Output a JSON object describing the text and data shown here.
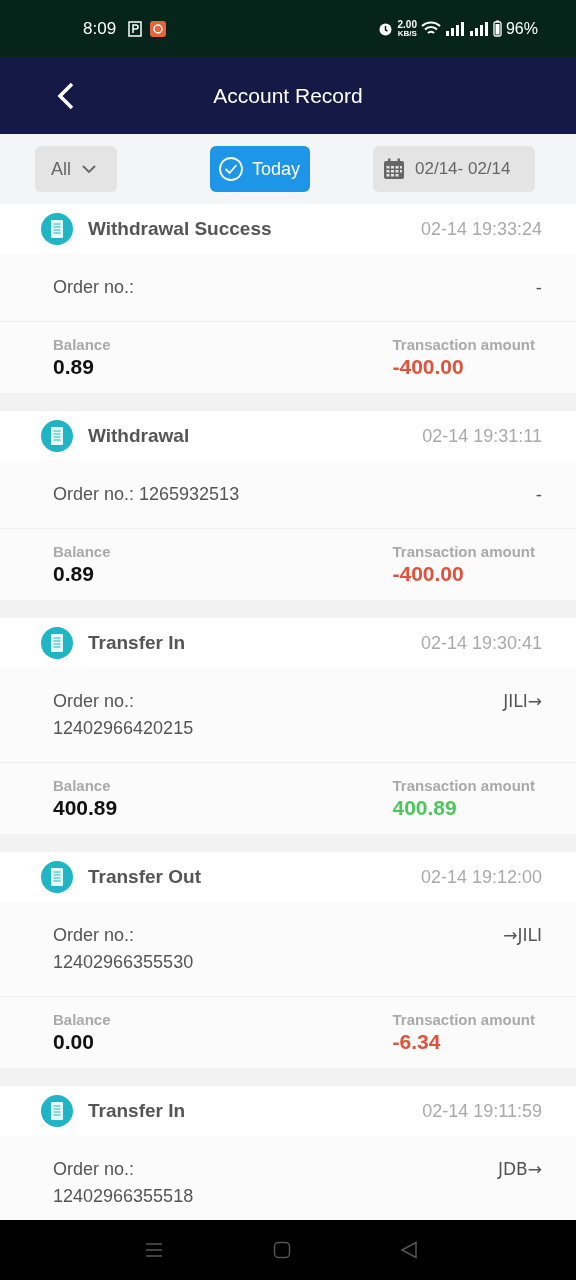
{
  "status_bar": {
    "time": "8:09",
    "speed": "2.00",
    "speed_unit": "KB/S",
    "battery": "96%"
  },
  "header": {
    "title": "Account Record"
  },
  "filters": {
    "type": {
      "label": "All"
    },
    "today": {
      "label": "Today",
      "selected": true
    },
    "date_range": {
      "label": "02/14- 02/14"
    }
  },
  "records": [
    {
      "title": "Withdrawal Success",
      "time": "02-14 19:33:24",
      "order": "Order no.:",
      "channel": "-",
      "balance_label": "Balance",
      "balance": "0.89",
      "amount_label": "Transaction amount",
      "amount": "-400.00",
      "color": "#e0533a"
    },
    {
      "title": "Withdrawal",
      "time": "02-14 19:31:11",
      "order": "Order no.: 1265932513",
      "channel": "-",
      "balance_label": "Balance",
      "balance": "0.89",
      "amount_label": "Transaction amount",
      "amount": "-400.00",
      "color": "#e0533a"
    },
    {
      "title": "Transfer In",
      "time": "02-14 19:30:41",
      "order": "Order no.: 12402966420215",
      "channel": "JILI→",
      "balance_label": "Balance",
      "balance": "400.89",
      "amount_label": "Transaction amount",
      "amount": "400.89",
      "color": "#4cc75a"
    },
    {
      "title": "Transfer Out",
      "time": "02-14 19:12:00",
      "order": "Order no.: 12402966355530",
      "channel": "→JILI",
      "balance_label": "Balance",
      "balance": "0.00",
      "amount_label": "Transaction amount",
      "amount": "-6.34",
      "color": "#e0533a"
    },
    {
      "title": "Transfer In",
      "time": "02-14 19:11:59",
      "order": "Order no.: 12402966355518",
      "channel": "JDB→"
    }
  ]
}
